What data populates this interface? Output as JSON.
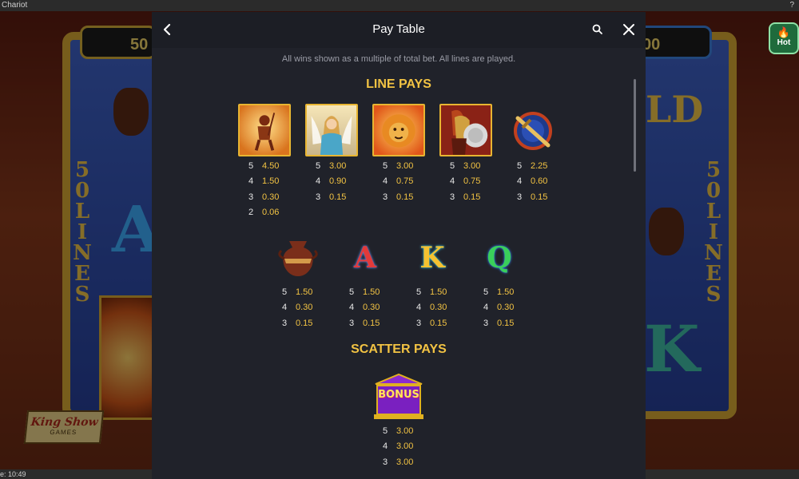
{
  "window": {
    "title": "Chariot",
    "help": "?"
  },
  "footer": {
    "clock": "e: 10:49"
  },
  "background": {
    "jackpot_left": "50",
    "jackpot_right": "00",
    "lines_left": "50 LINES",
    "lines_right": "50 LINES",
    "letter_a": "A",
    "letter_k": "K",
    "wild_fragment": "LD",
    "hot_button_label": "Hot",
    "brand": {
      "name": "King Show",
      "sub": "GAMES"
    }
  },
  "paytable": {
    "title": "Pay Table",
    "subtitle": "All wins shown as a multiple of total bet. All lines are played.",
    "line_pays_title": "LINE PAYS",
    "scatter_pays_title": "SCATTER PAYS",
    "row1": [
      {
        "icon": "chariot-warrior-symbol",
        "pays": [
          {
            "n": "5",
            "v": "4.50"
          },
          {
            "n": "4",
            "v": "1.50"
          },
          {
            "n": "3",
            "v": "0.30"
          },
          {
            "n": "2",
            "v": "0.06"
          }
        ]
      },
      {
        "icon": "goddess-symbol",
        "pays": [
          {
            "n": "5",
            "v": "3.00"
          },
          {
            "n": "4",
            "v": "0.90"
          },
          {
            "n": "3",
            "v": "0.15"
          }
        ]
      },
      {
        "icon": "lion-symbol",
        "pays": [
          {
            "n": "5",
            "v": "3.00"
          },
          {
            "n": "4",
            "v": "0.75"
          },
          {
            "n": "3",
            "v": "0.15"
          }
        ]
      },
      {
        "icon": "spartan-symbol",
        "pays": [
          {
            "n": "5",
            "v": "3.00"
          },
          {
            "n": "4",
            "v": "0.75"
          },
          {
            "n": "3",
            "v": "0.15"
          }
        ]
      },
      {
        "icon": "shield-sword-symbol",
        "pays": [
          {
            "n": "5",
            "v": "2.25"
          },
          {
            "n": "4",
            "v": "0.60"
          },
          {
            "n": "3",
            "v": "0.15"
          }
        ]
      }
    ],
    "row2": [
      {
        "icon": "vase-symbol",
        "pays": [
          {
            "n": "5",
            "v": "1.50"
          },
          {
            "n": "4",
            "v": "0.30"
          },
          {
            "n": "3",
            "v": "0.15"
          }
        ]
      },
      {
        "icon": "letter-a-symbol",
        "letter": "A",
        "pays": [
          {
            "n": "5",
            "v": "1.50"
          },
          {
            "n": "4",
            "v": "0.30"
          },
          {
            "n": "3",
            "v": "0.15"
          }
        ]
      },
      {
        "icon": "letter-k-symbol",
        "letter": "K",
        "pays": [
          {
            "n": "5",
            "v": "1.50"
          },
          {
            "n": "4",
            "v": "0.30"
          },
          {
            "n": "3",
            "v": "0.15"
          }
        ]
      },
      {
        "icon": "letter-q-symbol",
        "letter": "Q",
        "pays": [
          {
            "n": "5",
            "v": "1.50"
          },
          {
            "n": "4",
            "v": "0.30"
          },
          {
            "n": "3",
            "v": "0.15"
          }
        ]
      }
    ],
    "scatter": {
      "icon": "bonus-temple-symbol",
      "label": "BONUS",
      "pays": [
        {
          "n": "5",
          "v": "3.00"
        },
        {
          "n": "4",
          "v": "3.00"
        },
        {
          "n": "3",
          "v": "3.00"
        }
      ]
    }
  },
  "colors": {
    "accent_gold": "#f2c343",
    "modal_bg": "#20222a"
  }
}
